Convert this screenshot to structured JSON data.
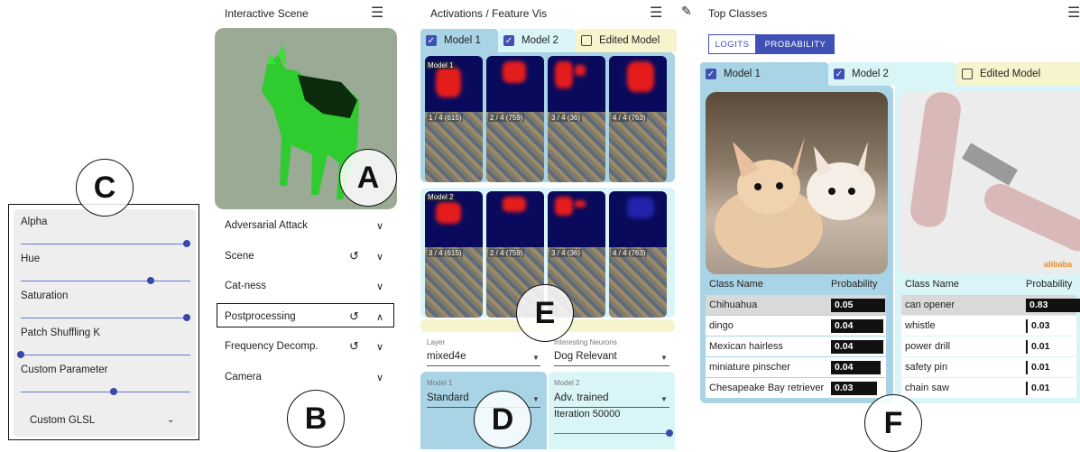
{
  "scene": {
    "title": "Interactive Scene",
    "menu_icon": "hamburger-icon"
  },
  "activations": {
    "title": "Activations / Feature Vis",
    "menu_icon": "hamburger-icon",
    "edit_icon": "pencil-icon"
  },
  "top_classes": {
    "title": "Top Classes",
    "menu_icon": "hamburger-icon",
    "seg": {
      "logits": "LOGITS",
      "probability": "PROBABILITY"
    }
  },
  "panel_letters": {
    "a": "A",
    "b": "B",
    "c": "C",
    "d": "D",
    "e": "E",
    "f": "F"
  },
  "accordion": [
    {
      "label": "Adversarial Attack",
      "reset": false,
      "open": false
    },
    {
      "label": "Scene",
      "reset": true,
      "open": false
    },
    {
      "label": "Cat-ness",
      "reset": false,
      "open": false
    },
    {
      "label": "Postprocessing",
      "reset": true,
      "open": true
    },
    {
      "label": "Frequency Decomp.",
      "reset": true,
      "open": false
    },
    {
      "label": "Camera",
      "reset": false,
      "open": false
    }
  ],
  "sliders": [
    {
      "label": "Alpha",
      "value": 1.0
    },
    {
      "label": "Hue",
      "value": 0.78
    },
    {
      "label": "Saturation",
      "value": 1.0
    },
    {
      "label": "Patch Shuffling K",
      "value": 0.0
    },
    {
      "label": "Custom Parameter",
      "value": 0.56
    }
  ],
  "glsl_label": "Custom GLSL",
  "model_tabs": [
    {
      "label": "Model 1",
      "checked": true,
      "color": "#a9d4e6"
    },
    {
      "label": "Model 2",
      "checked": true,
      "color": "#d9f5f7"
    },
    {
      "label": "Edited Model",
      "checked": false,
      "color": "#f6f4cc"
    }
  ],
  "grid_tags": {
    "m1": "Model 1",
    "m2": "Model 2"
  },
  "grid_captions": {
    "m1": [
      "1 / 4 (615)",
      "2 / 4 (759)",
      "3 / 4 (36)",
      "4 / 4 (763)"
    ],
    "m2": [
      "3 / 4 (615)",
      "2 / 4 (759)",
      "3 / 4 (36)",
      "4 / 4 (763)"
    ]
  },
  "controls": {
    "layer_label": "Layer",
    "layer_value": "mixed4e",
    "neurons_label": "Interesting Neurons",
    "neurons_value": "Dog Relevant",
    "m1_label": "Model 1",
    "m1_value": "Standard",
    "m2_label": "Model 2",
    "m2_value": "Adv. trained",
    "iteration": "Iteration 50000",
    "iteration_value": 1.0
  },
  "class_table": {
    "header": {
      "name": "Class Name",
      "prob": "Probability"
    },
    "model1": [
      {
        "name": "Chihuahua",
        "p": "0.05",
        "w": 1.0
      },
      {
        "name": "dingo",
        "p": "0.04",
        "w": 0.95
      },
      {
        "name": "Mexican hairless",
        "p": "0.04",
        "w": 0.95
      },
      {
        "name": "miniature pinscher",
        "p": "0.04",
        "w": 0.85
      },
      {
        "name": "Chesapeake Bay retriever",
        "p": "0.03",
        "w": 0.75
      }
    ],
    "model2": [
      {
        "name": "can opener",
        "p": "0.83",
        "w": 1.0
      },
      {
        "name": "whistle",
        "p": "0.03",
        "w": 0.0
      },
      {
        "name": "power drill",
        "p": "0.01",
        "w": 0.0
      },
      {
        "name": "safety pin",
        "p": "0.01",
        "w": 0.0
      },
      {
        "name": "chain saw",
        "p": "0.01",
        "w": 0.0
      }
    ]
  },
  "watermark": "alibaba"
}
